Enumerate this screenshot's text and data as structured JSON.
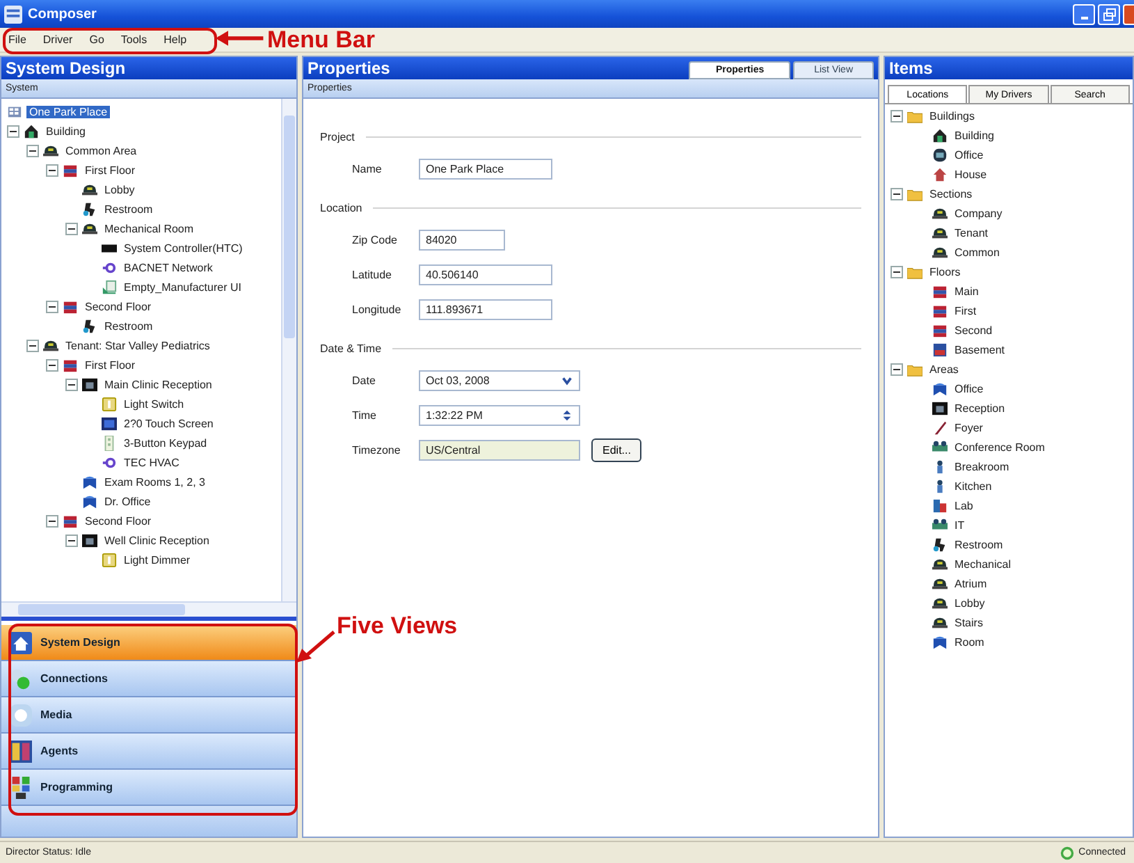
{
  "window": {
    "title": "Composer"
  },
  "menu": [
    "File",
    "Driver",
    "Go",
    "Tools",
    "Help"
  ],
  "system_panel": {
    "title": "System Design",
    "subtitle": "System",
    "tree": [
      {
        "label": "One Park Place",
        "kind": "site",
        "selected": true,
        "children": [
          {
            "label": "Building",
            "kind": "building",
            "selected": false,
            "expanded": true,
            "children": [
              {
                "label": "Common Area",
                "kind": "area",
                "selected": false,
                "expanded": true,
                "children": [
                  {
                    "label": "First Floor",
                    "kind": "floor",
                    "selected": false,
                    "expanded": true,
                    "children": [
                      {
                        "label": "Lobby",
                        "kind": "area",
                        "selected": false
                      },
                      {
                        "label": "Restroom",
                        "kind": "restroom",
                        "selected": false
                      },
                      {
                        "label": "Mechanical Room",
                        "kind": "area",
                        "selected": false,
                        "expanded": true,
                        "children": [
                          {
                            "label": "System Controller(HTC)",
                            "kind": "controller",
                            "selected": false
                          },
                          {
                            "label": "BACNET Network",
                            "kind": "network",
                            "selected": false
                          },
                          {
                            "label": "Empty_Manufacturer UI",
                            "kind": "module",
                            "selected": false
                          }
                        ]
                      }
                    ]
                  },
                  {
                    "label": "Second Floor",
                    "kind": "floor",
                    "selected": false,
                    "expanded": true,
                    "children": [
                      {
                        "label": "Restroom",
                        "kind": "restroom",
                        "selected": false
                      }
                    ]
                  }
                ]
              },
              {
                "label": "Tenant: Star Valley Pediatrics",
                "kind": "area",
                "selected": false,
                "expanded": true,
                "children": [
                  {
                    "label": "First Floor",
                    "kind": "floor",
                    "selected": false,
                    "expanded": true,
                    "children": [
                      {
                        "label": "Main Clinic Reception",
                        "kind": "reception",
                        "selected": false,
                        "expanded": true,
                        "children": [
                          {
                            "label": "Light Switch",
                            "kind": "switch",
                            "selected": false
                          },
                          {
                            "label": "2?0 Touch Screen",
                            "kind": "screen",
                            "selected": false
                          },
                          {
                            "label": "3-Button Keypad",
                            "kind": "keypad",
                            "selected": false
                          },
                          {
                            "label": "TEC HVAC",
                            "kind": "network",
                            "selected": false
                          }
                        ]
                      },
                      {
                        "label": "Exam Rooms 1, 2, 3",
                        "kind": "room",
                        "selected": false
                      },
                      {
                        "label": "Dr. Office",
                        "kind": "room",
                        "selected": false
                      }
                    ]
                  },
                  {
                    "label": "Second Floor",
                    "kind": "floor",
                    "selected": false,
                    "expanded": true,
                    "children": [
                      {
                        "label": "Well Clinic Reception",
                        "kind": "reception",
                        "selected": false,
                        "expanded": true,
                        "children": [
                          {
                            "label": "Light Dimmer",
                            "kind": "switch",
                            "selected": false
                          }
                        ]
                      }
                    ]
                  }
                ]
              }
            ]
          }
        ]
      }
    ]
  },
  "views": [
    {
      "label": "System Design",
      "kind": "design",
      "selected": true
    },
    {
      "label": "Connections",
      "kind": "connections",
      "selected": false
    },
    {
      "label": "Media",
      "kind": "media",
      "selected": false
    },
    {
      "label": "Agents",
      "kind": "agents",
      "selected": false
    },
    {
      "label": "Programming",
      "kind": "programming",
      "selected": false
    }
  ],
  "properties_panel": {
    "title": "Properties",
    "subtitle": "Properties",
    "tabs": [
      {
        "label": "Properties",
        "selected": true
      },
      {
        "label": "List View",
        "selected": false
      }
    ],
    "sections": [
      {
        "title": "Project",
        "fields": [
          {
            "label": "Name",
            "value": "One Park Place",
            "kind": "text"
          }
        ]
      },
      {
        "title": "Location",
        "fields": [
          {
            "label": "Zip Code",
            "value": "84020",
            "kind": "short"
          },
          {
            "label": "Latitude",
            "value": "40.506140",
            "kind": "text"
          },
          {
            "label": "Longitude",
            "value": "111.893671",
            "kind": "text"
          }
        ]
      },
      {
        "title": "Date & Time",
        "fields": [
          {
            "label": "Date",
            "value": "Oct 03, 2008",
            "kind": "date"
          },
          {
            "label": "Time",
            "value": "1:32:22 PM",
            "kind": "time"
          },
          {
            "label": "Timezone",
            "value": "US/Central",
            "kind": "readonly",
            "button": "Edit..."
          }
        ]
      }
    ]
  },
  "items_panel": {
    "title": "Items",
    "tabs": [
      {
        "label": "Locations",
        "selected": true
      },
      {
        "label": "My Drivers",
        "selected": false
      },
      {
        "label": "Search",
        "selected": false
      }
    ],
    "tree": [
      {
        "label": "Buildings",
        "kind": "folder",
        "expanded": true,
        "children": [
          {
            "label": "Building",
            "kind": "building"
          },
          {
            "label": "Office",
            "kind": "office"
          },
          {
            "label": "House",
            "kind": "house"
          }
        ]
      },
      {
        "label": "Sections",
        "kind": "folder",
        "expanded": true,
        "children": [
          {
            "label": "Company",
            "kind": "area"
          },
          {
            "label": "Tenant",
            "kind": "area"
          },
          {
            "label": "Common",
            "kind": "area"
          }
        ]
      },
      {
        "label": "Floors",
        "kind": "folder",
        "expanded": true,
        "children": [
          {
            "label": "Main",
            "kind": "floor"
          },
          {
            "label": "First",
            "kind": "floor"
          },
          {
            "label": "Second",
            "kind": "floor"
          },
          {
            "label": "Basement",
            "kind": "basement"
          }
        ]
      },
      {
        "label": "Areas",
        "kind": "folder",
        "expanded": true,
        "children": [
          {
            "label": "Office",
            "kind": "room"
          },
          {
            "label": "Reception",
            "kind": "reception"
          },
          {
            "label": "Foyer",
            "kind": "foyer"
          },
          {
            "label": "Conference Room",
            "kind": "people"
          },
          {
            "label": "Breakroom",
            "kind": "person"
          },
          {
            "label": "Kitchen",
            "kind": "person"
          },
          {
            "label": "Lab",
            "kind": "lab"
          },
          {
            "label": "IT",
            "kind": "people"
          },
          {
            "label": "Restroom",
            "kind": "restroom"
          },
          {
            "label": "Mechanical",
            "kind": "area"
          },
          {
            "label": "Atrium",
            "kind": "area"
          },
          {
            "label": "Lobby",
            "kind": "area"
          },
          {
            "label": "Stairs",
            "kind": "area"
          },
          {
            "label": "Room",
            "kind": "room"
          }
        ]
      }
    ]
  },
  "status_bar": {
    "text": "Director Status: Idle",
    "connection": "Connected"
  },
  "annotations": [
    {
      "text": "Menu Bar"
    },
    {
      "text": "Five Views"
    }
  ]
}
